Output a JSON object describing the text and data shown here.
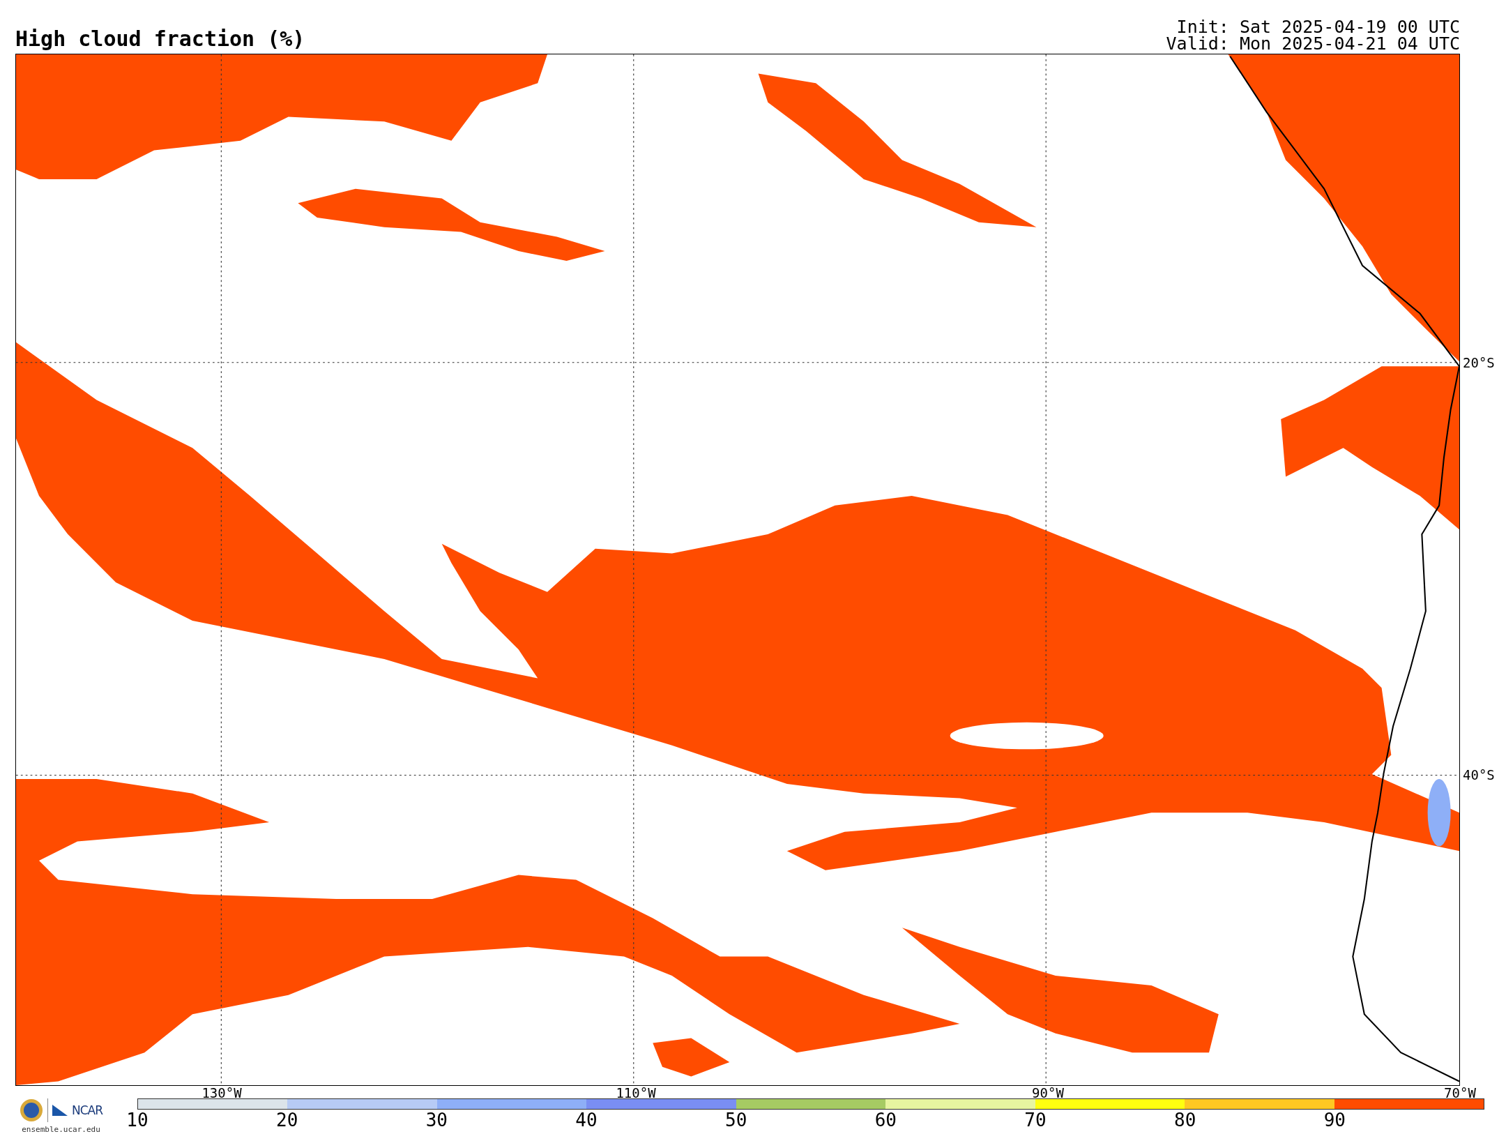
{
  "title": "High cloud fraction (%)",
  "times": [
    "Init: Sat 2025-04-19 00 UTC",
    "Valid: Mon 2025-04-21 04 UTC"
  ],
  "latitude_labels": [
    "20°S",
    "40°S"
  ],
  "longitude_labels": [
    "130°W",
    "110°W",
    "90°W",
    "70°W"
  ],
  "logo": {
    "text": "NCAR",
    "site": "ensemble.ucar.edu"
  },
  "colorbar": {
    "bins": [
      {
        "color": "#dce4ea"
      },
      {
        "color": "#b7cbf5"
      },
      {
        "color": "#8eaff7"
      },
      {
        "color": "#7a8ef3"
      },
      {
        "color": "#a6cb63"
      },
      {
        "color": "#e7f5a0"
      },
      {
        "color": "#ffff10"
      },
      {
        "color": "#ffc822"
      },
      {
        "color": "#ff4c00"
      }
    ],
    "ticks": [
      "10",
      "20",
      "30",
      "40",
      "50",
      "60",
      "70",
      "80",
      "90"
    ]
  }
}
